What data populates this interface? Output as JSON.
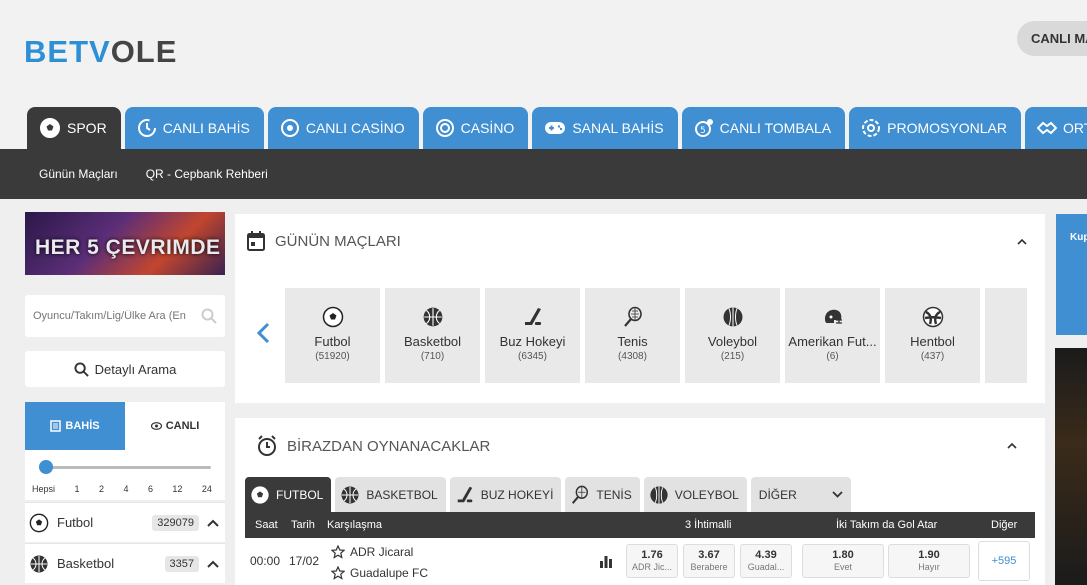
{
  "brand": {
    "logo_part1": "BETV",
    "logo_part2": "OLE",
    "accent": "#3f8fd2",
    "dark": "#3a3a3a"
  },
  "header": {
    "live_matches_label": "CANLI MA"
  },
  "nav": [
    {
      "label": "SPOR",
      "icon": "soccer-ball-icon",
      "active": true
    },
    {
      "label": "CANLI BAHİS",
      "icon": "live-clock-icon"
    },
    {
      "label": "CANLI CASİNO",
      "icon": "casino-chip-icon"
    },
    {
      "label": "CASİNO",
      "icon": "casino-icon"
    },
    {
      "label": "SANAL BAHİS",
      "icon": "gamepad-icon"
    },
    {
      "label": "CANLI TOMBALA",
      "icon": "tombala-icon"
    },
    {
      "label": "PROMOSYONLAR",
      "icon": "promo-icon"
    },
    {
      "label": "ORTAK",
      "icon": "handshake-icon"
    }
  ],
  "subnav": [
    "Günün Maçları",
    "QR - Cepbank Rehberi"
  ],
  "sidebar": {
    "banner_text": "HER 5 ÇEVRIMDE",
    "search_placeholder": "Oyuncu/Takım/Lig/Ülke Ara (En",
    "detail_search_label": "Detaylı Arama",
    "bahis_label": "BAHİS",
    "canli_label": "CANLI",
    "slider_labels": [
      "Hepsi",
      "1",
      "2",
      "4",
      "6",
      "12",
      "24"
    ],
    "sports": [
      {
        "name": "Futbol",
        "count": "329079",
        "icon": "soccer-ball-icon"
      },
      {
        "name": "Basketbol",
        "count": "3357",
        "icon": "basketball-icon"
      }
    ]
  },
  "todays_matches": {
    "title": "GÜNÜN MAÇLARI",
    "sports": [
      {
        "name": "Futbol",
        "count": "(51920)",
        "icon": "soccer-ball-icon"
      },
      {
        "name": "Basketbol",
        "count": "(710)",
        "icon": "basketball-icon"
      },
      {
        "name": "Buz Hokeyi",
        "count": "(6345)",
        "icon": "hockey-stick-icon"
      },
      {
        "name": "Tenis",
        "count": "(4308)",
        "icon": "tennis-racket-icon"
      },
      {
        "name": "Voleybol",
        "count": "(215)",
        "icon": "volleyball-icon"
      },
      {
        "name": "Amerikan Fut...",
        "count": "(6)",
        "icon": "football-helmet-icon"
      },
      {
        "name": "Hentbol",
        "count": "(437)",
        "icon": "handball-icon"
      }
    ]
  },
  "upcoming": {
    "title": "BİRAZDAN OYNANACAKLAR",
    "tabs": [
      {
        "label": "FUTBOL",
        "icon": "soccer-ball-icon",
        "active": true
      },
      {
        "label": "BASKETBOL",
        "icon": "basketball-icon"
      },
      {
        "label": "BUZ HOKEYİ",
        "icon": "hockey-stick-icon"
      },
      {
        "label": "TENİS",
        "icon": "tennis-racket-icon"
      },
      {
        "label": "VOLEYBOL",
        "icon": "volleyball-icon"
      }
    ],
    "other_label": "DİĞER",
    "columns": {
      "saat": "Saat",
      "tarih": "Tarih",
      "karsilasma": "Karşılaşma",
      "three_way": "3 İhtimalli",
      "btts": "İki Takım da Gol Atar",
      "other": "Diğer"
    },
    "matches": [
      {
        "time": "00:00",
        "date": "17/02",
        "home": "ADR Jicaral",
        "away": "Guadalupe FC",
        "odds": [
          {
            "value": "1.76",
            "label": "ADR Jic..."
          },
          {
            "value": "3.67",
            "label": "Berabere"
          },
          {
            "value": "4.39",
            "label": "Guadal..."
          },
          {
            "value": "1.80",
            "label": "Evet"
          },
          {
            "value": "1.90",
            "label": "Hayır"
          }
        ],
        "more": "+595"
      }
    ]
  },
  "coupon": {
    "label": "Kup"
  }
}
